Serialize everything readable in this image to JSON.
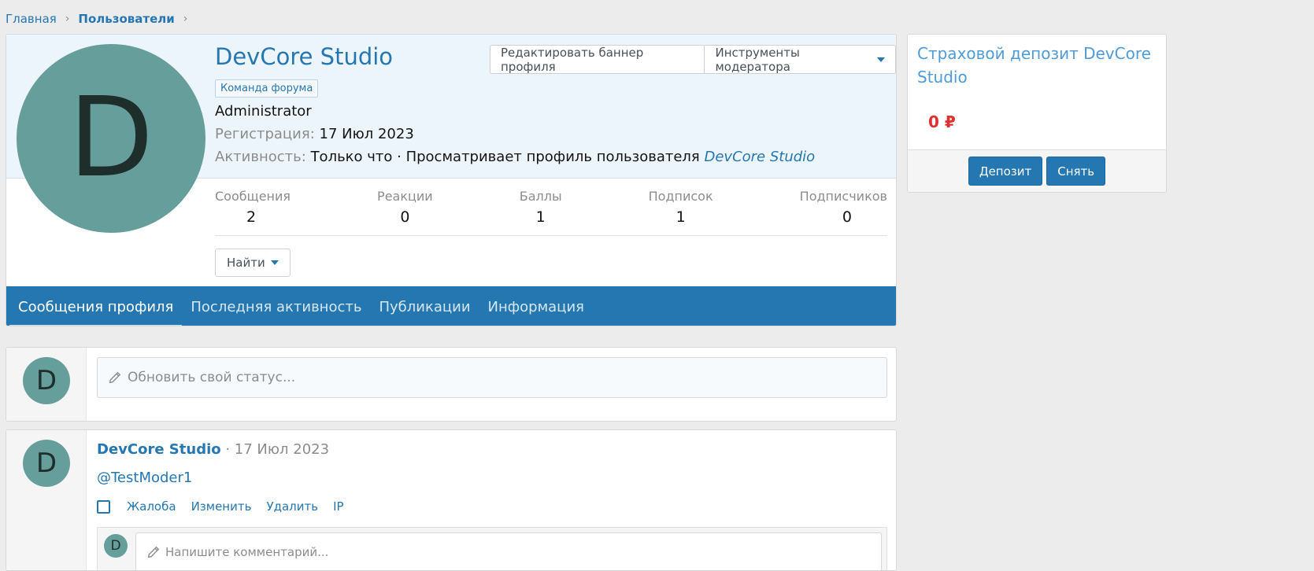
{
  "breadcrumb": {
    "home": "Главная",
    "current": "Пользователи"
  },
  "profile": {
    "avatar_letter": "D",
    "username": "DevCore Studio",
    "badge": "Команда форума",
    "title": "Administrator",
    "reg_label": "Регистрация:",
    "reg_value": "17 Июл 2023",
    "activity_label": "Активность:",
    "activity_text": "Только что · Просматривает профиль пользователя",
    "activity_user": "DevCore Studio",
    "edit_banner": "Редактировать баннер профиля",
    "mod_tools": "Инструменты модератора",
    "find": "Найти"
  },
  "stats": [
    {
      "label": "Сообщения",
      "value": "2"
    },
    {
      "label": "Реакции",
      "value": "0"
    },
    {
      "label": "Баллы",
      "value": "1"
    },
    {
      "label": "Подписок",
      "value": "1"
    },
    {
      "label": "Подписчиков",
      "value": "0"
    }
  ],
  "tabs": [
    "Сообщения профиля",
    "Последняя активность",
    "Публикации",
    "Информация"
  ],
  "deposit": {
    "title": "Страховой депозит DevCore Studio",
    "amount": "0 ₽",
    "deposit_btn": "Депозит",
    "withdraw_btn": "Снять"
  },
  "status": {
    "placeholder": "Обновить свой статус..."
  },
  "post": {
    "author": "DevCore Studio",
    "date": "· 17 Июл 2023",
    "body": "@TestModer1",
    "actions": [
      "Жалоба",
      "Изменить",
      "Удалить",
      "IP"
    ],
    "comment_placeholder": "Напишите комментарий..."
  },
  "colors": {
    "accent": "#2577b1",
    "avatar": "#669e9b",
    "amount": "#e03030"
  }
}
